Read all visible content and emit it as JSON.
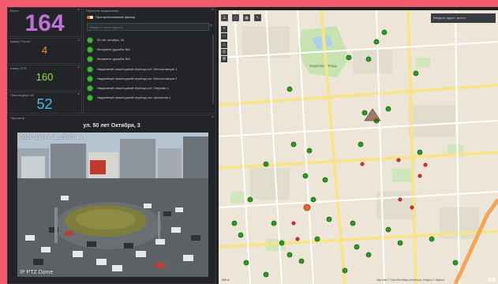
{
  "stats": {
    "total": {
      "title": "Всего",
      "value": "164"
    },
    "ptz": {
      "title": "Камер \"Поток\"",
      "value": "4"
    },
    "lpr": {
      "title": "Камер LPR",
      "value": "160"
    },
    "pedestrian": {
      "title": "Пешеходных КВ",
      "value": "52"
    }
  },
  "list_panel": {
    "title": "Перечень видеокамер",
    "toggle_label": "Пространственный фильтр",
    "search_placeholder": "Введите часть адреса",
    "items": [
      "50 лет октября, 34",
      "Монумент дружбы №1",
      "Монумент дружбы №2",
      "Надземный пешеходный переход ост. Метеостанция 1",
      "Надземный пешеходный переход ост. Метеостанция 2",
      "Надземный пешеходный переход ост. Озерная 1",
      "Надземный пешеходный переход ост. Школьная 1"
    ]
  },
  "camera_panel": {
    "title": "Просмотр",
    "camera_name": "ул. 50 лет Октября, 3",
    "timestamp": "2020-10-03 11:25:03 Вт",
    "overlay_label": "IP PTZ Dome"
  },
  "map": {
    "search_placeholder": "Введите адрес, место",
    "attribution": "Map data © OpenStreetMap contributors, Imagery © Mapbox",
    "scale": "500 m",
    "logo": "es",
    "park_label": "Берёзовая Роща"
  },
  "colors": {
    "background": "#f15a6a",
    "accent_total": "#c071d9",
    "accent_ptz": "#f0913a",
    "accent_lpr": "#8ee24a",
    "accent_pedestrian": "#4fb6e8",
    "marker_ok": "#2e9a1f",
    "marker_alert": "#d63030"
  }
}
